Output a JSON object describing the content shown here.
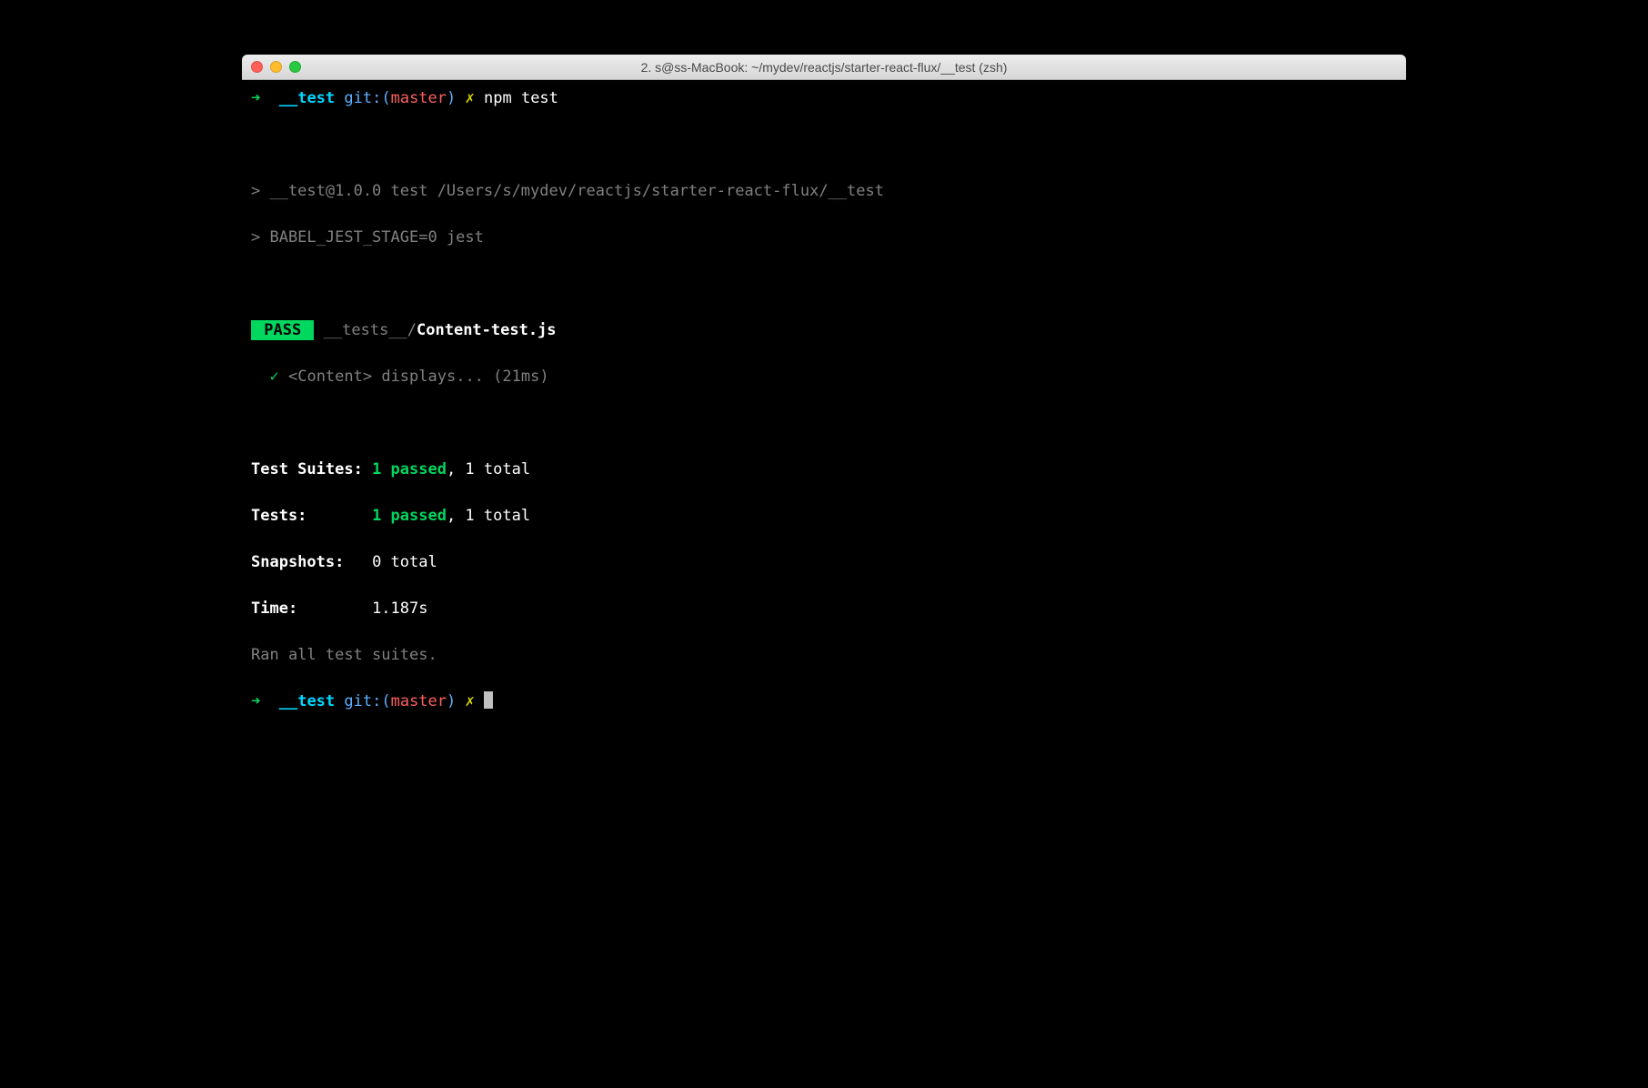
{
  "window": {
    "title": "2. s@ss-MacBook: ~/mydev/reactjs/starter-react-flux/__test (zsh)"
  },
  "prompt1": {
    "arrow": "➜",
    "dir": "__test",
    "git_label": "git:(",
    "branch": "master",
    "git_close": ")",
    "dirty": "✗",
    "command": "npm test"
  },
  "output": {
    "line1": "> __test@1.0.0 test /Users/s/mydev/reactjs/starter-react-flux/__test",
    "line2": "> BABEL_JEST_STAGE=0 jest",
    "pass_label": " PASS ",
    "test_dir": " __tests__/",
    "test_file": "Content-test.js",
    "check": "✓",
    "test_desc": "<Content> displays... (21ms)",
    "suites_label": "Test Suites: ",
    "suites_pass": "1 passed",
    "suites_total": ", 1 total",
    "tests_label": "Tests:       ",
    "tests_pass": "1 passed",
    "tests_total": ", 1 total",
    "snapshots_label": "Snapshots:   ",
    "snapshots_value": "0 total",
    "time_label": "Time:        ",
    "time_value": "1.187s",
    "ran_all": "Ran all test suites."
  },
  "prompt2": {
    "arrow": "➜",
    "dir": "__test",
    "git_label": "git:(",
    "branch": "master",
    "git_close": ")",
    "dirty": "✗"
  }
}
